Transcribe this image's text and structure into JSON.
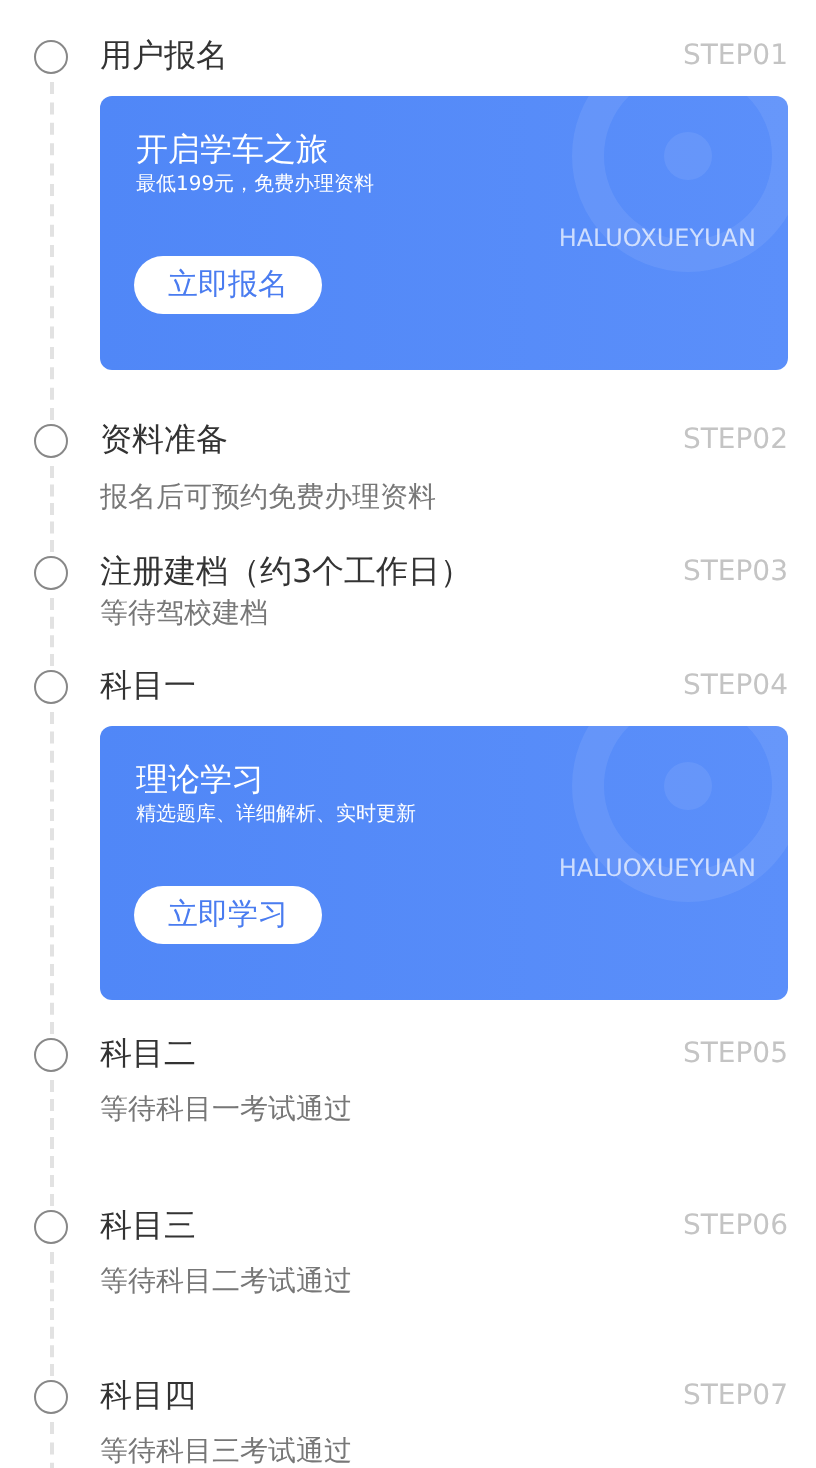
{
  "steps": [
    {
      "title": "用户报名",
      "step": "STEP01",
      "kind": "card",
      "card": {
        "title": "开启学车之旅",
        "subtitle": "最低199元，免费办理资料",
        "brand": "HALUOXUEYUAN",
        "button": "立即报名"
      }
    },
    {
      "title": "资料准备",
      "step": "STEP02",
      "kind": "text",
      "description": "报名后可预约免费办理资料"
    },
    {
      "title": "注册建档（约3个工作日）",
      "step": "STEP03",
      "kind": "text",
      "description": "等待驾校建档"
    },
    {
      "title": "科目一",
      "step": "STEP04",
      "kind": "card",
      "card": {
        "title": "理论学习",
        "subtitle": "精选题库、详细解析、实时更新",
        "brand": "HALUOXUEYUAN",
        "button": "立即学习"
      }
    },
    {
      "title": "科目二",
      "step": "STEP05",
      "kind": "text",
      "description": "等待科目一考试通过"
    },
    {
      "title": "科目三",
      "step": "STEP06",
      "kind": "text",
      "description": "等待科目二考试通过"
    },
    {
      "title": "科目四",
      "step": "STEP07",
      "kind": "text",
      "description": "等待科目三考试通过"
    }
  ]
}
